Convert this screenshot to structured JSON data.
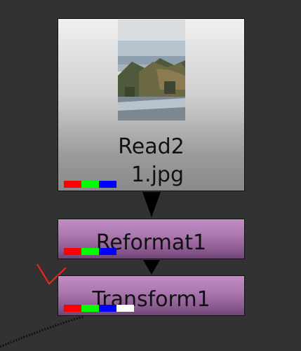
{
  "nodes": {
    "read": {
      "title": "Read2",
      "file": "1.jpg",
      "channels": [
        "red",
        "green",
        "blue"
      ]
    },
    "reformat": {
      "title": "Reformat1",
      "channels": [
        "red",
        "green",
        "blue"
      ]
    },
    "transform": {
      "title": "Transform1",
      "channels": [
        "red",
        "green",
        "blue",
        "alpha"
      ]
    }
  },
  "colors": {
    "canvas_background": "#323232",
    "node_purple": "#ab79af",
    "node_gray": "#cfcfcf",
    "channel_red": "#ff0000",
    "channel_green": "#00ff00",
    "channel_blue": "#0000ff",
    "channel_alpha": "#ffffff",
    "check_mark": "#ff2020"
  },
  "icons": {
    "edge_arrow": "arrow-down-icon",
    "check_mark": "check-mark-icon"
  }
}
